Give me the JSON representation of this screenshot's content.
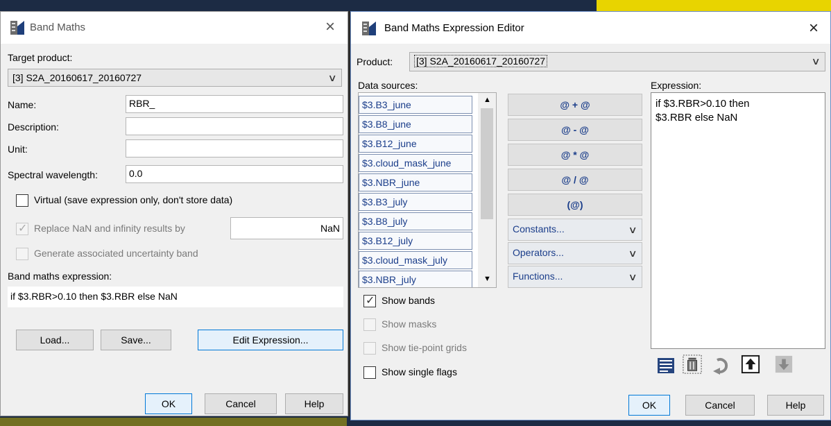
{
  "left_dialog": {
    "title": "Band Maths",
    "target_product_label": "Target product:",
    "target_product_value": "[3] S2A_20160617_20160727",
    "name_label": "Name:",
    "name_value": "RBR_",
    "description_label": "Description:",
    "description_value": "",
    "unit_label": "Unit:",
    "unit_value": "",
    "spectral_label": "Spectral wavelength:",
    "spectral_value": "0.0",
    "virtual_label": "Virtual (save expression only, don't store data)",
    "replace_nan_label": "Replace NaN and infinity results by",
    "replace_nan_value": "NaN",
    "uncertainty_label": "Generate associated uncertainty band",
    "expression_label": "Band maths expression:",
    "expression_value": "if $3.RBR>0.10 then $3.RBR else NaN",
    "load_button": "Load...",
    "save_button": "Save...",
    "edit_button": "Edit Expression...",
    "ok_button": "OK",
    "cancel_button": "Cancel",
    "help_button": "Help"
  },
  "right_dialog": {
    "title": "Band Maths Expression Editor",
    "product_label": "Product:",
    "product_value": "[3] S2A_20160617_20160727",
    "data_sources_label": "Data sources:",
    "data_sources": [
      "$3.B3_june",
      "$3.B8_june",
      "$3.B12_june",
      "$3.cloud_mask_june",
      "$3.NBR_june",
      "$3.B3_july",
      "$3.B8_july",
      "$3.B12_july",
      "$3.cloud_mask_july",
      "$3.NBR_july"
    ],
    "operators": [
      "@ + @",
      "@ - @",
      "@ * @",
      "@ / @",
      "(@)"
    ],
    "constants_label": "Constants...",
    "operators_label": "Operators...",
    "functions_label": "Functions...",
    "expression_label": "Expression:",
    "expression_line1": "if $3.RBR>0.10 then",
    "expression_line2": "$3.RBR else NaN",
    "show_bands_label": "Show bands",
    "show_masks_label": "Show masks",
    "show_tiepoint_label": "Show tie-point grids",
    "show_flags_label": "Show single flags",
    "ok_button": "OK",
    "cancel_button": "Cancel",
    "help_button": "Help"
  },
  "colors": {
    "dialog_bg": "#f0f0f0",
    "link_blue": "#1a3d8a",
    "focus_blue": "#0078d7"
  }
}
